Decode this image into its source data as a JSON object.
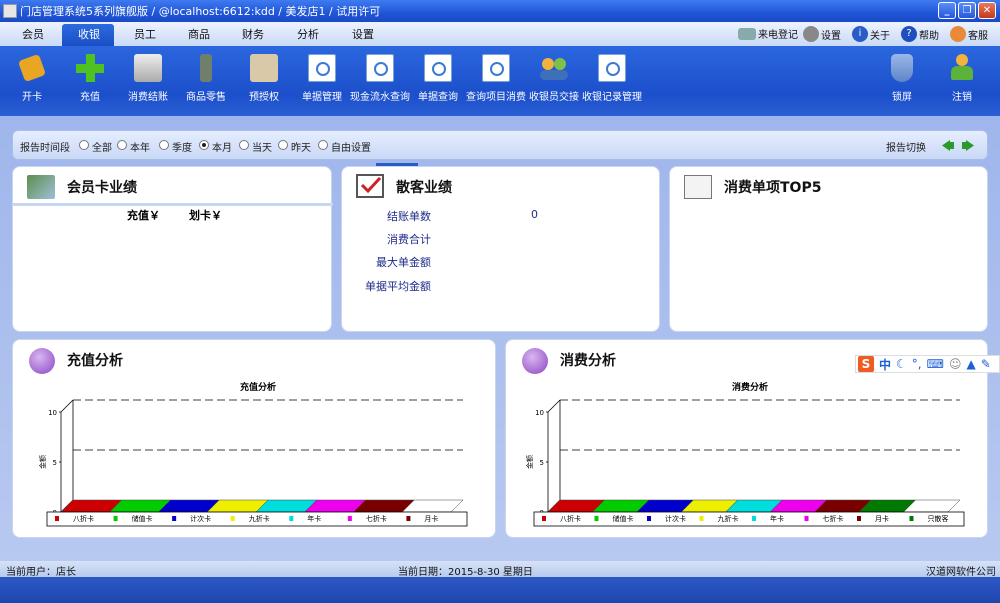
{
  "window": {
    "title": "门店管理系统5系列旗舰版 / @localhost:6612:kdd / 美发店1 / 试用许可"
  },
  "menu": {
    "items": [
      "会员",
      "收银",
      "员工",
      "商品",
      "财务",
      "分析",
      "设置"
    ],
    "active": "收银",
    "right": [
      "来电登记",
      "设置",
      "关于",
      "帮助",
      "客服"
    ]
  },
  "toolbar": {
    "tools": [
      "开卡",
      "充值",
      "消费结账",
      "商品零售",
      "预授权",
      "单据管理",
      "现金流水查询",
      "单据查询",
      "查询项目消费",
      "收银员交接",
      "收银记录管理"
    ],
    "right_tools": [
      "锁屏",
      "注销"
    ]
  },
  "filter": {
    "label": "报告时间段",
    "options": [
      "全部",
      "本年",
      "季度",
      "本月",
      "当天",
      "昨天",
      "自由设置"
    ],
    "selected": "本月",
    "switch_label": "报告切换"
  },
  "member_panel": {
    "title": "会员卡业绩",
    "col1": "充值￥",
    "col2": "划卡￥"
  },
  "guest_panel": {
    "title": "散客业绩",
    "rows": [
      {
        "label": "结账单数",
        "value": "0"
      },
      {
        "label": "消费合计",
        "value": ""
      },
      {
        "label": "最大单金额",
        "value": ""
      },
      {
        "label": "单据平均金额",
        "value": ""
      }
    ]
  },
  "top5_panel": {
    "title": "消费单项TOP5"
  },
  "recharge_panel": {
    "title": "充值分析"
  },
  "consume_panel": {
    "title": "消费分析"
  },
  "chart_data": [
    {
      "type": "bar",
      "title": "充值分析",
      "ylabel": "金额",
      "ylim": [
        0,
        10
      ],
      "yticks": [
        "0",
        "5",
        "10"
      ],
      "categories": [
        "八折卡",
        "储值卡",
        "计次卡",
        "九折卡",
        "年卡",
        "七折卡",
        "月卡"
      ],
      "series": [
        {
          "values": [
            0,
            0,
            0,
            0,
            0,
            0,
            0
          ]
        }
      ],
      "colors": [
        "#cc0000",
        "#00cc00",
        "#0000cc",
        "#eeee00",
        "#00dddd",
        "#ee00ee",
        "#7a0000"
      ],
      "grid": true,
      "legend": "bottom"
    },
    {
      "type": "bar",
      "title": "消费分析",
      "ylabel": "金额",
      "ylim": [
        0,
        10
      ],
      "yticks": [
        "0",
        "5",
        "10"
      ],
      "categories": [
        "八折卡",
        "储值卡",
        "计次卡",
        "九折卡",
        "年卡",
        "七折卡",
        "月卡",
        "只散客"
      ],
      "series": [
        {
          "values": [
            0,
            0,
            0,
            0,
            0,
            0,
            0,
            0
          ]
        }
      ],
      "colors": [
        "#cc0000",
        "#00cc00",
        "#0000cc",
        "#eeee00",
        "#00dddd",
        "#ee00ee",
        "#7a0000",
        "#007a00"
      ],
      "grid": true,
      "legend": "bottom"
    }
  ],
  "status": {
    "user_label": "当前用户：店长",
    "date_label": "当前日期：2015-8-30 星期日",
    "company": "汉道网软件公司"
  },
  "ime": {
    "lang": "中"
  }
}
